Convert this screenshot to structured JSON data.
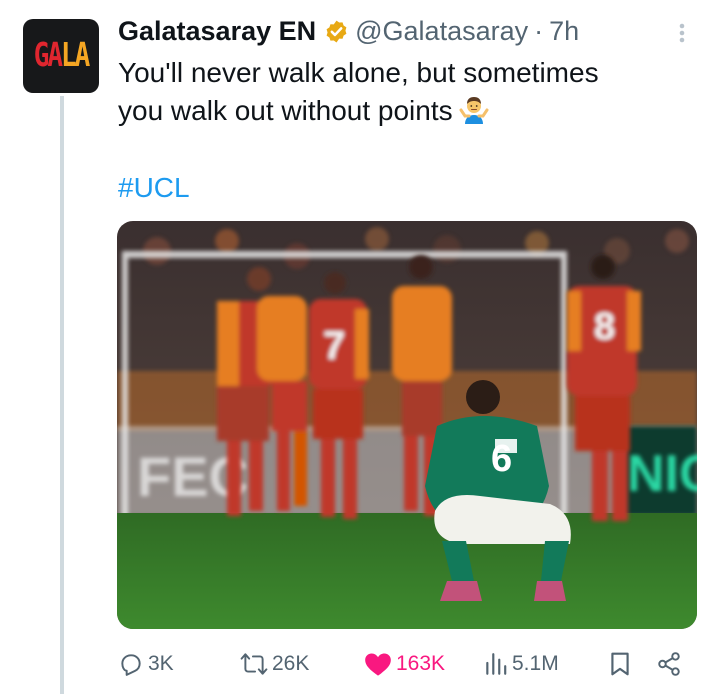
{
  "tweet": {
    "display_name": "Galatasaray EN",
    "handle": "@Galatasaray",
    "separator": "·",
    "time": "7h",
    "text_line1": "You'll never walk alone, but sometimes",
    "text_line2": "you walk out without points",
    "emoji_icon": "person-shrugging-emoji",
    "hashtag": "#UCL",
    "verified_badge_color": "#e8a914"
  },
  "avatar": {
    "logo_text_main": "GA",
    "logo_text_accent": "LA",
    "logo_colors": {
      "main": "#e0262f",
      "accent": "#f5a623",
      "background": "#17181a"
    }
  },
  "media": {
    "player_shirt_number": "6",
    "opponent_numbers": [
      "7",
      "8"
    ],
    "board_text_left": "FEC",
    "board_text_right": "NIG"
  },
  "actions": {
    "replies": "3K",
    "reposts": "26K",
    "likes": "163K",
    "views": "5.1M",
    "like_color": "#f91880",
    "icon_color": "#536471"
  }
}
